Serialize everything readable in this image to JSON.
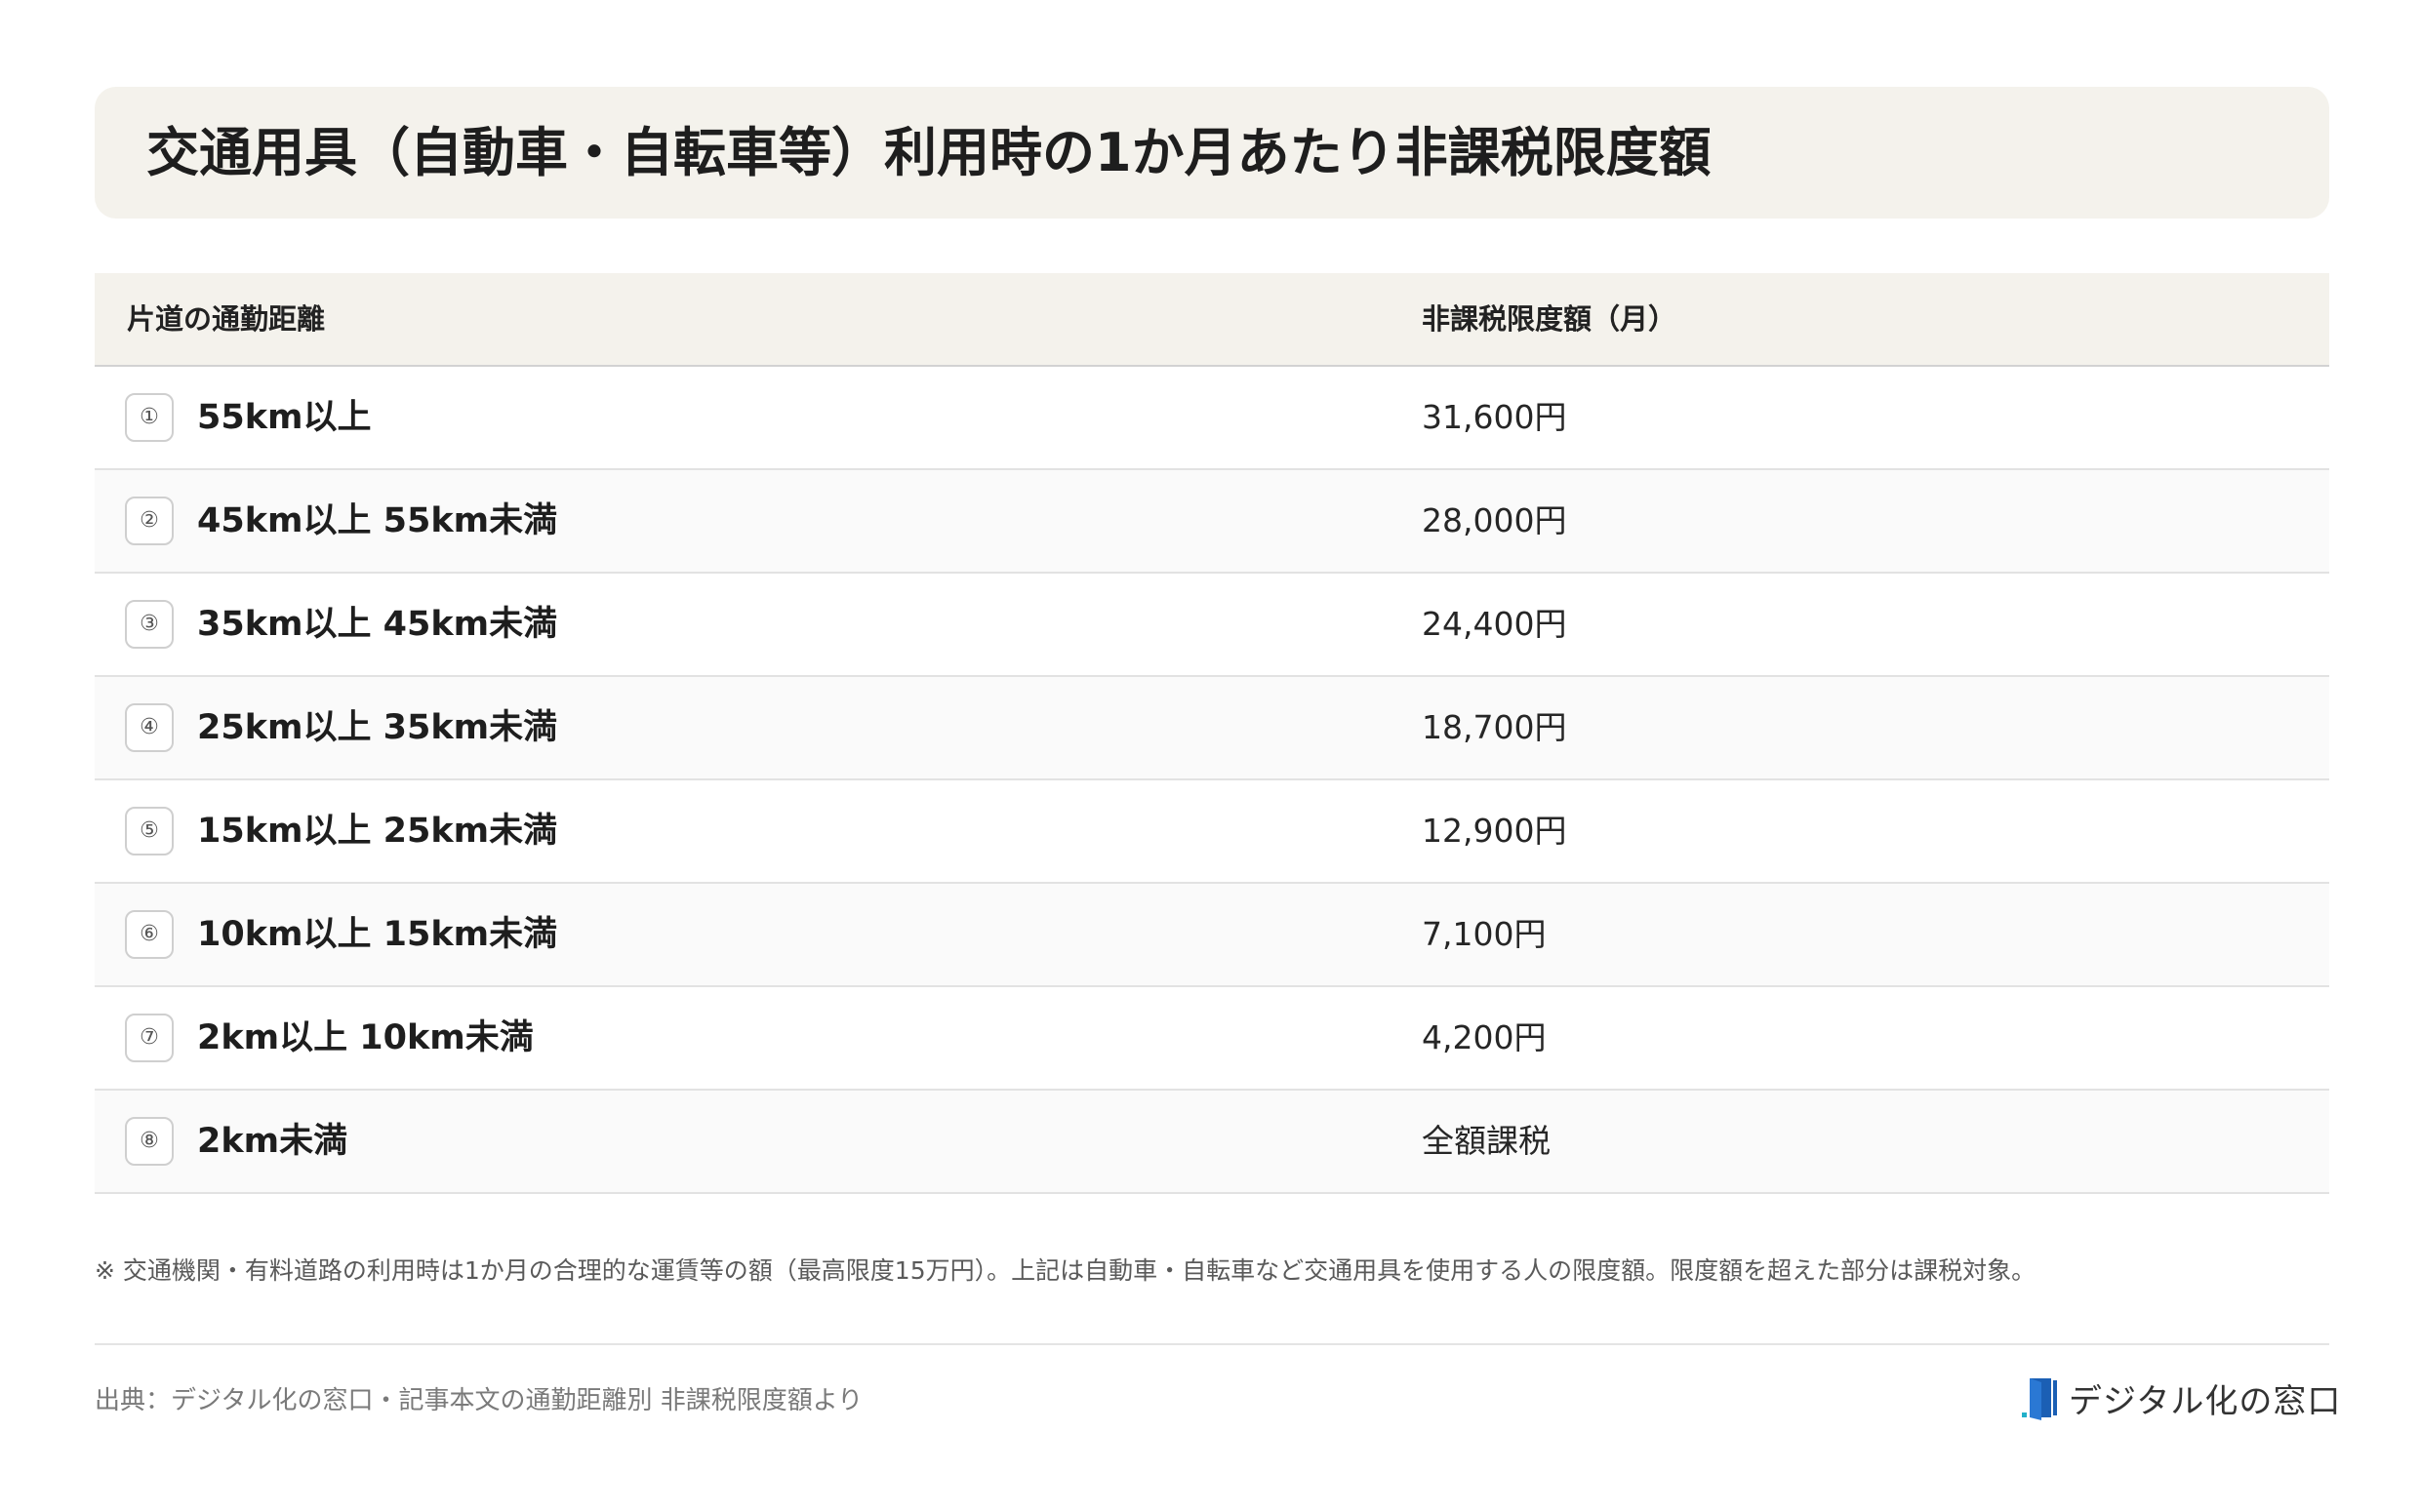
{
  "title": "交通用具（自動車・自転車等）利用時の1か月あたり非課税限度額",
  "table": {
    "headers": [
      "片道の通勤距離",
      "非課税限度額（月）"
    ],
    "rows": [
      {
        "badge": "①",
        "range": "55km以上",
        "amount": "31,600円"
      },
      {
        "badge": "②",
        "range": "45km以上 55km未満",
        "amount": "28,000円"
      },
      {
        "badge": "③",
        "range": "35km以上 45km未満",
        "amount": "24,400円"
      },
      {
        "badge": "④",
        "range": "25km以上 35km未満",
        "amount": "18,700円"
      },
      {
        "badge": "⑤",
        "range": "15km以上 25km未満",
        "amount": "12,900円"
      },
      {
        "badge": "⑥",
        "range": "10km以上 15km未満",
        "amount": "7,100円"
      },
      {
        "badge": "⑦",
        "range": "2km以上 10km未満",
        "amount": "4,200円"
      },
      {
        "badge": "⑧",
        "range": "2km未満",
        "amount": "全額課税"
      }
    ]
  },
  "note": "※ 交通機関・有料道路の利用時は1か月の合理的な運賃等の額（最高限度15万円）。上記は自動車・自転車など交通用具を使用する人の限度額。限度額を超えた部分は課税対象。",
  "source": "出典：デジタル化の窓口・記事本文の通勤距離別 非課税限度額より",
  "logo": {
    "text": "デジタル化の窓口",
    "icon": "door-logo-icon",
    "colors": {
      "primary": "#1b5fb4",
      "accent": "#22b0c9"
    }
  },
  "colors": {
    "header_bg": "#f4f2ec",
    "alt_row_bg": "#fafafa"
  }
}
